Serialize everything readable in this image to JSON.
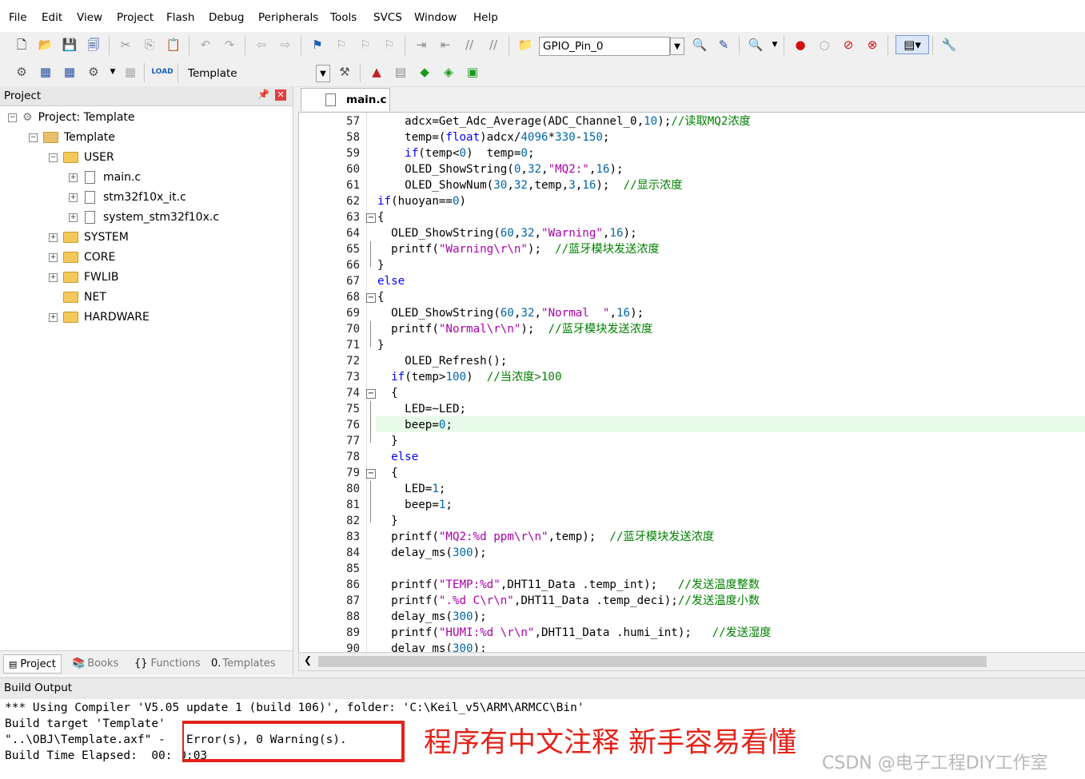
{
  "menu": [
    "File",
    "Edit",
    "View",
    "Project",
    "Flash",
    "Debug",
    "Peripherals",
    "Tools",
    "SVCS",
    "Window",
    "Help"
  ],
  "toolbar": {
    "find_value": "GPIO_Pin_0",
    "target_value": "Template"
  },
  "project_panel": {
    "title": "Project",
    "pin_icon": "pin-icon",
    "close_icon": "close-icon",
    "tree": [
      {
        "label": "Project: Template",
        "level": 0,
        "icon": "project-icon",
        "expanded": true
      },
      {
        "label": "Template",
        "level": 1,
        "icon": "target-icon",
        "expanded": true
      },
      {
        "label": "USER",
        "level": 2,
        "icon": "folder-icon",
        "expanded": true
      },
      {
        "label": "main.c",
        "level": 3,
        "icon": "file-icon"
      },
      {
        "label": "stm32f10x_it.c",
        "level": 3,
        "icon": "file-icon"
      },
      {
        "label": "system_stm32f10x.c",
        "level": 3,
        "icon": "file-icon"
      },
      {
        "label": "SYSTEM",
        "level": 2,
        "icon": "folder-icon",
        "expanded": false
      },
      {
        "label": "CORE",
        "level": 2,
        "icon": "folder-icon",
        "expanded": false
      },
      {
        "label": "FWLIB",
        "level": 2,
        "icon": "folder-icon",
        "expanded": false
      },
      {
        "label": "NET",
        "level": 2,
        "icon": "folder-icon",
        "expanded": false
      },
      {
        "label": "HARDWARE",
        "level": 2,
        "icon": "folder-icon",
        "expanded": false
      }
    ],
    "tabs": [
      "Project",
      "Books",
      "Functions",
      "Templates"
    ]
  },
  "editor": {
    "tab_label": "main.c",
    "lines": [
      {
        "n": "57",
        "text": "    adcx=Get_Adc_Average(ADC_Channel_0,10);//读取MQ2浓度"
      },
      {
        "n": "58",
        "text": "    temp=(float)adcx/4096*330-150;"
      },
      {
        "n": "59",
        "text": "    if(temp<0)  temp=0;"
      },
      {
        "n": "60",
        "text": "    OLED_ShowString(0,32,\"MQ2:\",16);"
      },
      {
        "n": "61",
        "text": "    OLED_ShowNum(30,32,temp,3,16);  //显示浓度"
      },
      {
        "n": "62",
        "text": "if(huoyan==0)"
      },
      {
        "n": "63",
        "text": "{"
      },
      {
        "n": "64",
        "text": "  OLED_ShowString(60,32,\"Warning\",16);"
      },
      {
        "n": "65",
        "text": "  printf(\"Warning\\r\\n\");  //蓝牙模块发送浓度"
      },
      {
        "n": "66",
        "text": "}"
      },
      {
        "n": "67",
        "text": "else"
      },
      {
        "n": "68",
        "text": "{"
      },
      {
        "n": "69",
        "text": "  OLED_ShowString(60,32,\"Normal  \",16);"
      },
      {
        "n": "70",
        "text": "  printf(\"Normal\\r\\n\");  //蓝牙模块发送浓度"
      },
      {
        "n": "71",
        "text": "}"
      },
      {
        "n": "72",
        "text": "    OLED_Refresh();"
      },
      {
        "n": "73",
        "text": "  if(temp>100)  //当浓度>100"
      },
      {
        "n": "74",
        "text": "  {"
      },
      {
        "n": "75",
        "text": "    LED=~LED;"
      },
      {
        "n": "76",
        "text": "    beep=0;"
      },
      {
        "n": "77",
        "text": "  }"
      },
      {
        "n": "78",
        "text": "  else"
      },
      {
        "n": "79",
        "text": "  {"
      },
      {
        "n": "80",
        "text": "    LED=1;"
      },
      {
        "n": "81",
        "text": "    beep=1;"
      },
      {
        "n": "82",
        "text": "  }"
      },
      {
        "n": "83",
        "text": "  printf(\"MQ2:%d ppm\\r\\n\",temp);  //蓝牙模块发送浓度"
      },
      {
        "n": "84",
        "text": "  delay_ms(300);"
      },
      {
        "n": "85",
        "text": ""
      },
      {
        "n": "86",
        "text": "  printf(\"TEMP:%d\",DHT11_Data .temp_int);   //发送温度整数"
      },
      {
        "n": "87",
        "text": "  printf(\".%d C\\r\\n\",DHT11_Data .temp_deci);//发送温度小数"
      },
      {
        "n": "88",
        "text": "  delay_ms(300);"
      },
      {
        "n": "89",
        "text": "  printf(\"HUMI:%d \\r\\n\",DHT11_Data .humi_int);   //发送湿度"
      },
      {
        "n": "90",
        "text": "  delay_ms(300);"
      }
    ]
  },
  "build_output": {
    "title": "Build Output",
    "lines": [
      "*** Using Compiler 'V5.05 update 1 (build 106)', folder: 'C:\\Keil_v5\\ARM\\ARMCC\\Bin'",
      "Build target 'Template'",
      "\"..\\OBJ\\Template.axf\" - 0 Error(s), 0 Warning(s).",
      "Build Time Elapsed:  00:00:03"
    ],
    "annotation": "程序有中文注释  新手容易看懂",
    "watermark": "CSDN @电子工程DIY工作室"
  },
  "colors": {
    "keyword": "#0000ff",
    "number": "#0066aa",
    "string": "#aa00aa",
    "comment": "#008000",
    "annotation": "#e2231a",
    "highlight_line": "#e8fbe8"
  }
}
